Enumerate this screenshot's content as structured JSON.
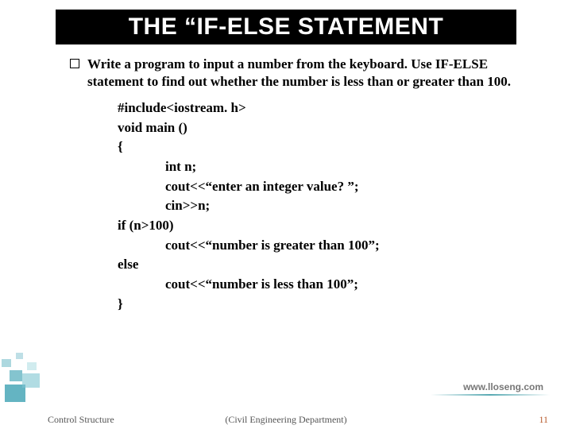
{
  "title": "THE “IF-ELSE STATEMENT",
  "prompt": "Write a program to input a number from the keyboard. Use IF-ELSE statement to find out whether the number is less than or greater than 100.",
  "code": {
    "l1": "#include<iostream. h>",
    "l2": "void main ()",
    "l3": "{",
    "l4": "int n;",
    "l5": "cout<<“enter an integer value? ”;",
    "l6": "cin>>n;",
    "l7": "if (n>100)",
    "l8": "cout<<“number is greater than 100”;",
    "l9": "else",
    "l10": "cout<<“number is less than 100”;",
    "l11": "}"
  },
  "footer": {
    "left": "Control Structure",
    "center": "(Civil Engineering Department)",
    "page": "11"
  },
  "watermark": "www.lloseng.com"
}
